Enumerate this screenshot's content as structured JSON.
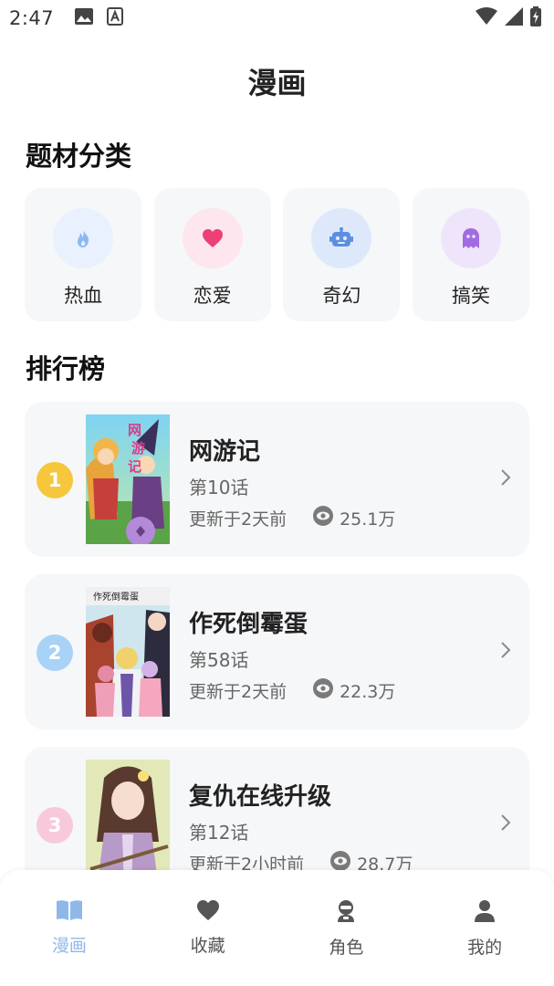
{
  "status_bar": {
    "time": "2:47",
    "left_icons": [
      "image-icon",
      "font-a-icon"
    ],
    "right_icons": [
      "wifi-icon",
      "signal-icon",
      "battery-icon"
    ]
  },
  "header": {
    "title": "漫画"
  },
  "categories": {
    "title": "题材分类",
    "items": [
      {
        "label": "热血",
        "icon": "flame-icon",
        "bg": "#e8f1fd",
        "color": "#8ab8f3"
      },
      {
        "label": "恋爱",
        "icon": "heart-icon",
        "bg": "#fde6ee",
        "color": "#ee3f76"
      },
      {
        "label": "奇幻",
        "icon": "robot-icon",
        "bg": "#dde9fb",
        "color": "#5b8fe0"
      },
      {
        "label": "搞笑",
        "icon": "ghost-icon",
        "bg": "#efe5fb",
        "color": "#a16ce0"
      }
    ]
  },
  "ranking": {
    "title": "排行榜",
    "items": [
      {
        "rank": "1",
        "badge_color": "#f6c73c",
        "name": "网游记",
        "episode": "第10话",
        "updated": "更新于2天前",
        "views": "25.1万",
        "cover_text": "网游记"
      },
      {
        "rank": "2",
        "badge_color": "#a9d2f7",
        "name": "作死倒霉蛋",
        "episode": "第58话",
        "updated": "更新于2天前",
        "views": "22.3万",
        "cover_text": "作死倒霉蛋"
      },
      {
        "rank": "3",
        "badge_color": "#f8c9dc",
        "name": "复仇在线升级",
        "episode": "第12话",
        "updated": "更新于2小时前",
        "views": "28.7万"
      }
    ]
  },
  "bottom_nav": {
    "items": [
      {
        "label": "漫画",
        "icon": "book-icon",
        "active": true
      },
      {
        "label": "收藏",
        "icon": "heart-icon",
        "active": false
      },
      {
        "label": "角色",
        "icon": "character-icon",
        "active": false
      },
      {
        "label": "我的",
        "icon": "person-icon",
        "active": false
      }
    ],
    "active_color": "#8fb8ea"
  }
}
